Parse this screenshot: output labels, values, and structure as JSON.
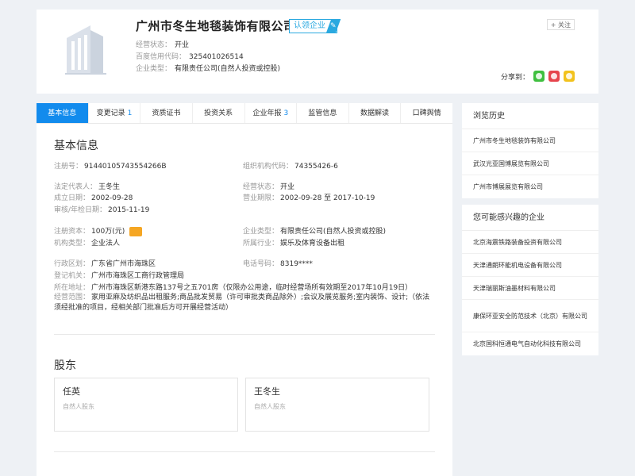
{
  "company": {
    "name": "广州市冬生地毯装饰有限公司",
    "badge": "认领企业",
    "follow": "+ 关注",
    "share_label": "分享到：",
    "lines": [
      {
        "label": "经营状态：",
        "value": "开业"
      },
      {
        "label": "百度信用代码：",
        "value": "325401026514"
      },
      {
        "label": "企业类型：",
        "value": "有限责任公司(自然人投资或控股)"
      }
    ]
  },
  "tabs": [
    {
      "label": "基本信息",
      "count": ""
    },
    {
      "label": "变更记录",
      "count": "1"
    },
    {
      "label": "资质证书",
      "count": ""
    },
    {
      "label": "投资关系",
      "count": ""
    },
    {
      "label": "企业年报",
      "count": "3"
    },
    {
      "label": "监管信息",
      "count": ""
    },
    {
      "label": "数据解读",
      "count": ""
    },
    {
      "label": "口碑舆情",
      "count": ""
    }
  ],
  "basic": {
    "title": "基本信息",
    "reg_no": {
      "label": "注册号：",
      "value": "91440105743554266B"
    },
    "org_code": {
      "label": "组织机构代码：",
      "value": "74355426-6"
    },
    "legal_rep": {
      "label": "法定代表人：",
      "value": "王冬生"
    },
    "status": {
      "label": "经营状态：",
      "value": "开业"
    },
    "established": {
      "label": "成立日期：",
      "value": "2002-09-28"
    },
    "term": {
      "label": "营业期限：",
      "value": "2002-09-28 至 2017-10-19"
    },
    "approved": {
      "label": "审核/年检日期：",
      "value": "2015-11-19"
    },
    "capital": {
      "label": "注册资本：",
      "value": "100万(元)"
    },
    "ent_type": {
      "label": "企业类型：",
      "value": "有限责任公司(自然人投资或控股)"
    },
    "org_type": {
      "label": "机构类型：",
      "value": "企业法人"
    },
    "industry": {
      "label": "所属行业：",
      "value": "娱乐及体育设备出租"
    },
    "region": {
      "label": "行政区划：",
      "value": "广东省广州市海珠区"
    },
    "phone": {
      "label": "电话号码：",
      "value": "8319****"
    },
    "authority": {
      "label": "登记机关：",
      "value": "广州市海珠区工商行政管理局"
    },
    "address": {
      "label": "所在地址：",
      "value": "广州市海珠区新港东路137号之五701房（仅限办公用途，临时经营场所有效期至2017年10月19日）"
    },
    "scope": {
      "label": "经营范围：",
      "value": "家用亚麻及纺织品出租服务;商品批发贸易（许可审批类商品除外）;会议及展览服务;室内装饰、设计;（依法须经批准的项目，经相关部门批准后方可开展经营活动）"
    }
  },
  "shareholders": {
    "title": "股东",
    "items": [
      {
        "name": "任英",
        "type": "自然人股东"
      },
      {
        "name": "王冬生",
        "type": "自然人股东"
      }
    ]
  },
  "history": {
    "title": "浏览历史",
    "items": [
      "广州市冬生地毯装饰有限公司",
      "武汉光亚国博展览有限公司",
      "广州市博展展览有限公司"
    ]
  },
  "related": {
    "title": "您可能感兴趣的企业",
    "items": [
      "北京海震铁路装备投资有限公司",
      "天津通朗环能机电设备有限公司",
      "天津瑞丽斯油墨材料有限公司",
      "康保环亚安全防范技术（北京）有限公司",
      "北京国科恒通电气自动化科技有限公司"
    ]
  }
}
